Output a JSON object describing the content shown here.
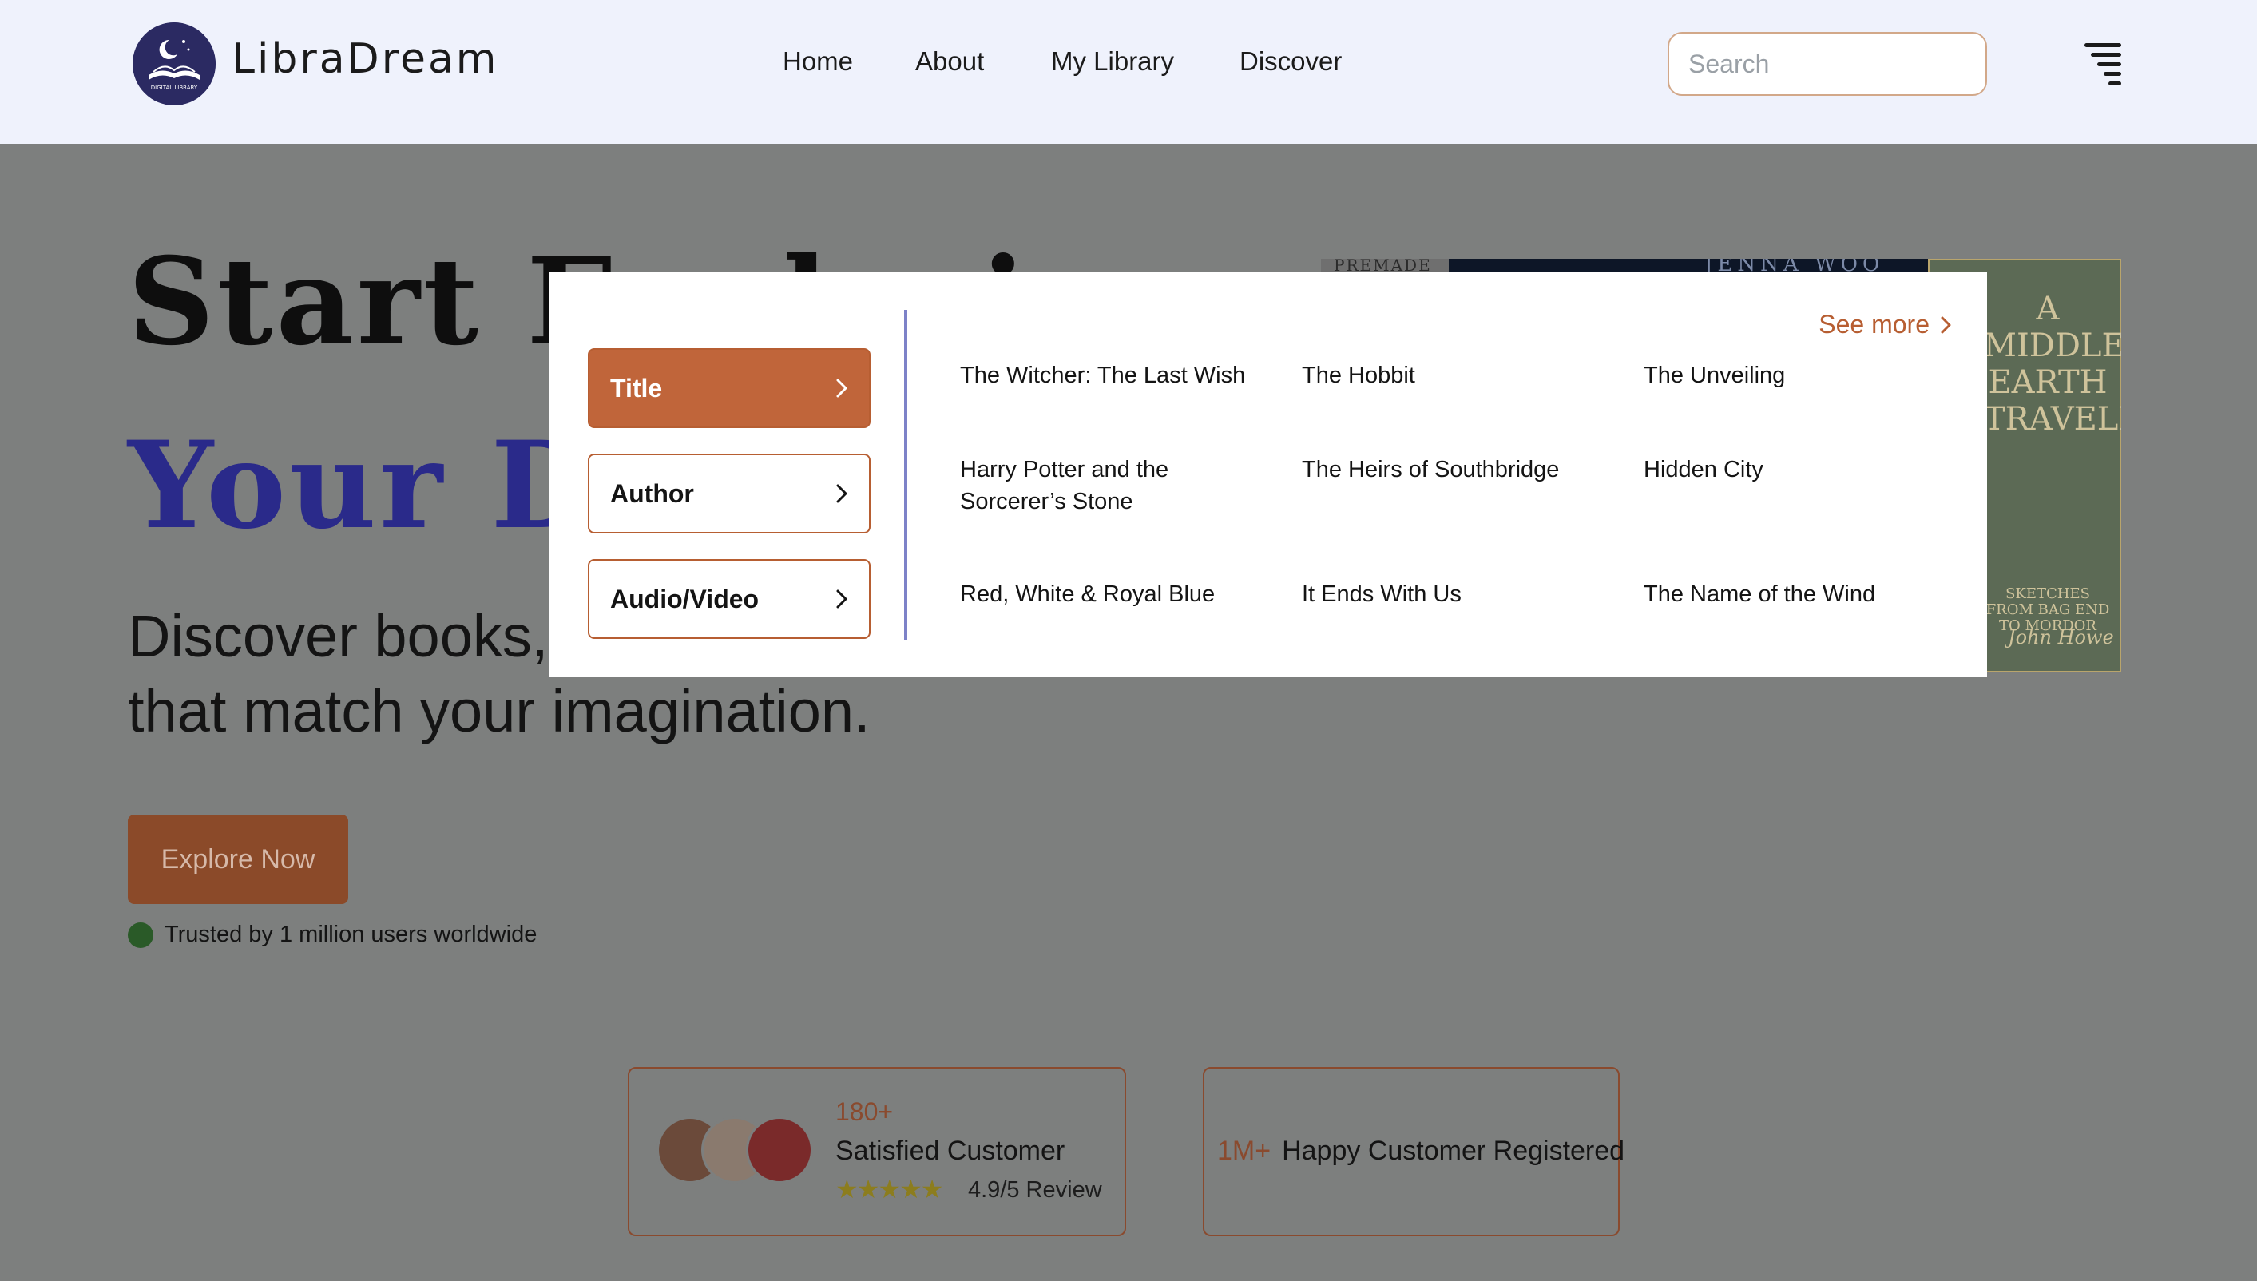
{
  "header": {
    "brand": "LibraDream",
    "logo_text": "DIGITAL LIBRARY",
    "nav": [
      "Home",
      "About",
      "My Library",
      "Discover"
    ],
    "search_placeholder": "Search"
  },
  "hero": {
    "line1": "Start Exploring",
    "line2": "Your Dream",
    "subtitle_line1": "Discover books, stories and videos",
    "subtitle_line2": "that match your imagination.",
    "explore_label": "Explore Now",
    "trusted": "Trusted by 1 million users worldwide"
  },
  "books": {
    "cover1_text": "PREMADE",
    "cover2_text": "JENNA WOO",
    "cover3_title": "A MIDDLE-EARTH TRAVELLER",
    "cover3_subtitle": "SKETCHES FROM BAG END TO MORDOR",
    "cover3_author": "John Howe"
  },
  "stats": {
    "satisfied_count": "180+",
    "satisfied_label": "Satisfied Customer",
    "rating_stars": 5,
    "review": "4.9/5 Review",
    "registered_count": "1M+",
    "registered_label": "Happy Customer Registered"
  },
  "dropdown": {
    "categories": [
      {
        "label": "Title",
        "active": true
      },
      {
        "label": "Author",
        "active": false
      },
      {
        "label": "Audio/Video",
        "active": false
      }
    ],
    "see_more": "See more",
    "items": [
      "The Witcher: The Last Wish",
      "The Hobbit",
      "The Unveiling",
      "Harry Potter and the Sorcerer’s Stone",
      "The Heirs of Southbridge",
      "Hidden City",
      "Red, White & Royal Blue",
      "It Ends With Us",
      "The Name of the Wind"
    ]
  },
  "colors": {
    "accent": "#c0653a",
    "header_bg": "#eff2fc",
    "divider": "#7d82c8",
    "overlay": "#7d7f7e"
  }
}
